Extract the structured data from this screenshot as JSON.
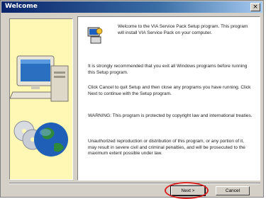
{
  "window": {
    "title": "Welcome",
    "close_symbol": "×"
  },
  "content": {
    "welcome": "Welcome to the VIA Service Pack Setup program. This program will install VIA Service Pack on your computer.",
    "recommend": "It is strongly recommended that you exit all Windows programs before running this Setup program.",
    "cancel_info": "Click Cancel to quit Setup and then close any programs you have running. Click Next to continue with the Setup program.",
    "warning": "WARNING: This program is protected by copyright law and international treaties.",
    "unauthorized": "Unauthorized reproduction or distribution of this program, or any portion of it, may result in severe civil and criminal penalties, and will be prosecuted to the maximum extent possible under law."
  },
  "buttons": {
    "next": "Next >",
    "cancel": "Cancel"
  },
  "icons": {
    "close": "close-icon",
    "setup": "setup-icon",
    "computer": "computer-illustration",
    "discs": "disc-icon",
    "globe": "globe-icon"
  },
  "colors": {
    "titlebar_start": "#0a246a",
    "titlebar_end": "#a6caf0",
    "dialog": "#d4d0c8",
    "art_background": "#fff8b4",
    "highlight": "#d92020"
  }
}
